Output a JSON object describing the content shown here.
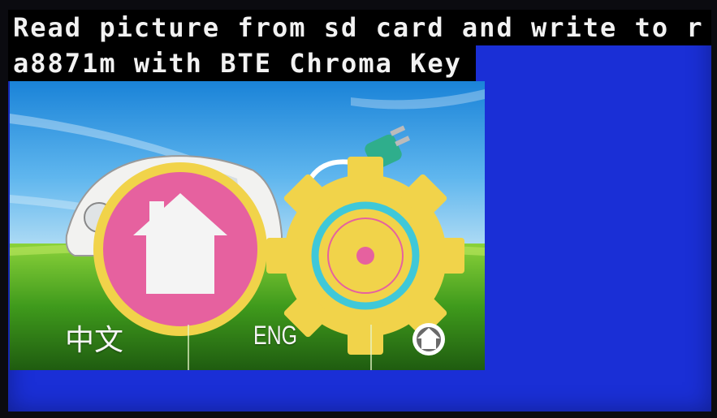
{
  "title": {
    "line1": "Read picture from sd card and write to r",
    "line2": "a8871m with BTE Chroma Key"
  },
  "menu": {
    "chinese_label": "中文",
    "english_label": "ENG",
    "home_button_icon": "home-icon",
    "settings_button_icon": "gear-icon",
    "small_home_icon": "home-icon"
  },
  "colors": {
    "screen_blue": "#1a2fd6",
    "home_pink": "#e6619f",
    "ring_yellow": "#f1d34a",
    "gear_cyan": "#3fc8d8"
  }
}
